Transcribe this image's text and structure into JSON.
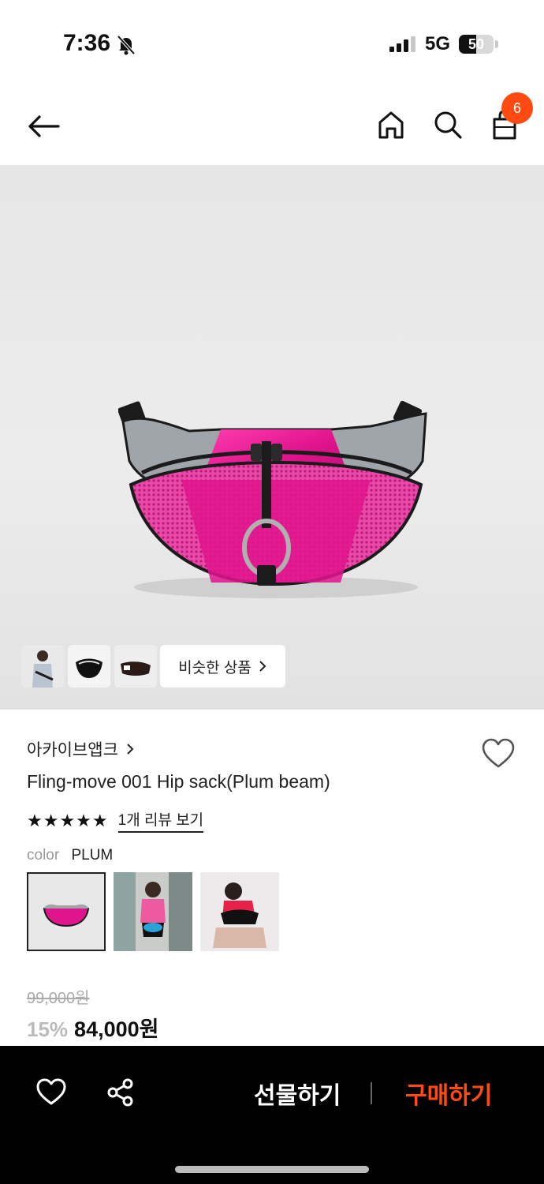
{
  "status_bar": {
    "time": "7:36",
    "network": "5G",
    "battery": "50",
    "battery_level": 0.5,
    "icons": [
      "bell-muted-icon",
      "signal-icon",
      "battery-icon"
    ]
  },
  "nav": {
    "back_icon": "arrow-left-icon",
    "home_icon": "home-icon",
    "search_icon": "search-icon",
    "cart_icon": "shopping-bag-icon",
    "cart_count": "6"
  },
  "gallery": {
    "similar_label": "비슷한 상품",
    "chevron_icon": "chevron-right-icon"
  },
  "product": {
    "brand": "아카이브앱크",
    "title": "Fling-move 001 Hip sack(Plum beam)",
    "stars": "★★★★★",
    "rating": 5,
    "review_link": "1개 리뷰 보기",
    "option_label": "color",
    "option_value": "PLUM",
    "original_price": "99,000원",
    "discount": "15%",
    "price": "84,000원"
  },
  "bottom_bar": {
    "gift_label": "선물하기",
    "buy_label": "구매하기",
    "heart_icon": "heart-outline-icon",
    "share_icon": "share-icon"
  },
  "colors": {
    "accent": "#ff4b12",
    "bag_pink": "#e0148c",
    "bag_gray": "#9fa5a9"
  }
}
